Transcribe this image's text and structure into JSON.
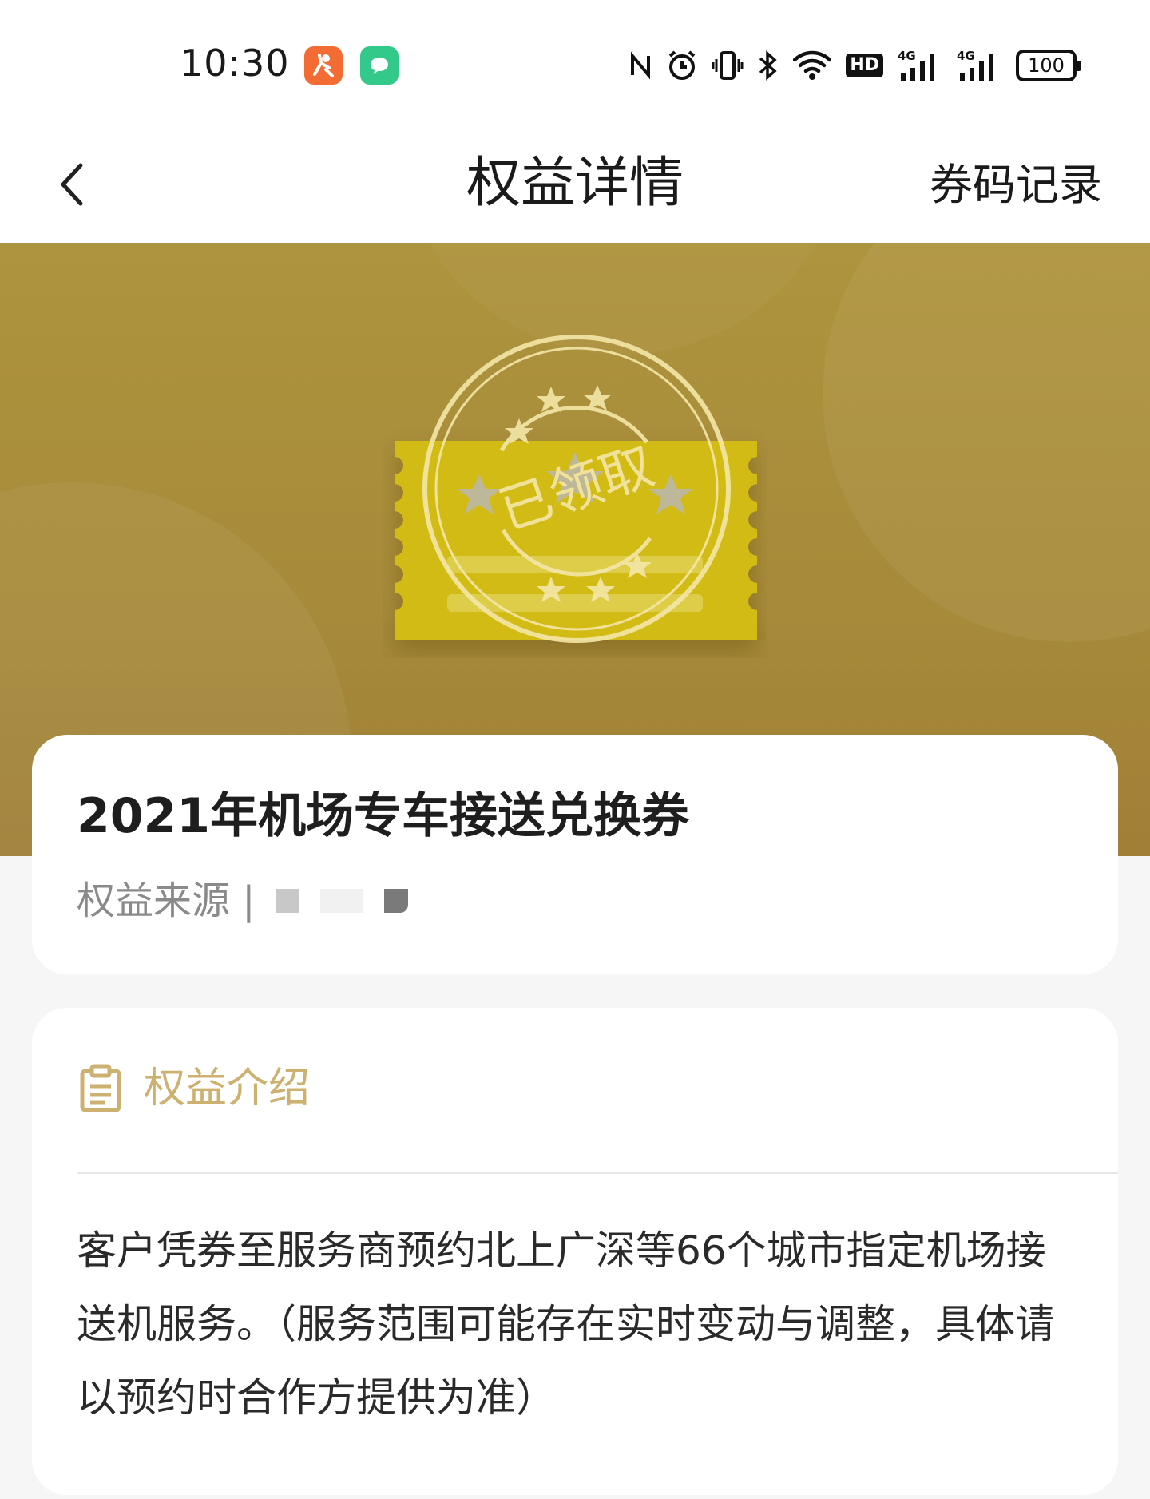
{
  "status_bar": {
    "time": "10:30",
    "network_1": "4G",
    "network_2": "4G",
    "hd_label": "HD",
    "battery": "100"
  },
  "nav": {
    "title": "权益详情",
    "action_label": "券码记录"
  },
  "hero": {
    "stamp_text": "已领取"
  },
  "benefit": {
    "title": "2021年机场专车接送兑换券",
    "source_label": "权益来源 |"
  },
  "intro": {
    "heading": "权益介绍",
    "body": "客户凭券至服务商预约北上广深等66个城市指定机场接送机服务。（服务范围可能存在实时变动与调整，具体请以预约时合作方提供为准）"
  },
  "colors": {
    "hero_gold": "#ae943e",
    "accent_gold": "#cdb170",
    "ticket_yellow": "#d8c21a"
  }
}
